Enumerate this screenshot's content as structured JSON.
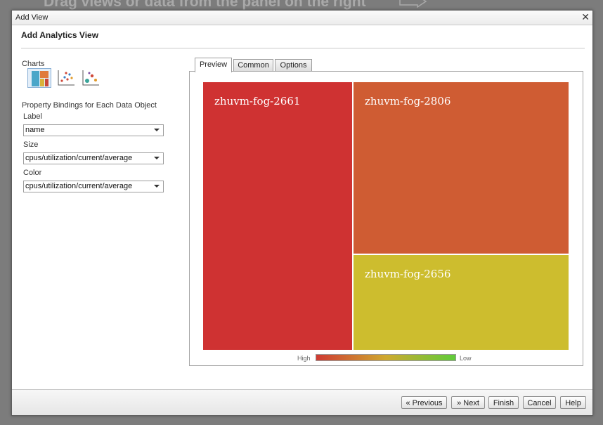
{
  "background": {
    "hint_text": "Drag views or data from the panel on the right"
  },
  "window": {
    "title": "Add View",
    "close_glyph": "✕"
  },
  "dialog": {
    "heading": "Add Analytics View"
  },
  "left": {
    "charts_label": "Charts",
    "chart_types": [
      {
        "name": "treemap",
        "icon": "treemap-icon",
        "selected": true
      },
      {
        "name": "scatter",
        "icon": "scatter-plot-icon",
        "selected": false
      },
      {
        "name": "bubble",
        "icon": "bubble-chart-icon",
        "selected": false
      }
    ],
    "bindings_title": "Property Bindings for Each Data Object",
    "label_caption": "Label",
    "label_value": "name",
    "size_caption": "Size",
    "size_value": "cpus/utilization/current/average",
    "color_caption": "Color",
    "color_value": "cpus/utilization/current/average"
  },
  "tabs": [
    {
      "label": "Preview",
      "active": true
    },
    {
      "label": "Common",
      "active": false
    },
    {
      "label": "Options",
      "active": false
    }
  ],
  "preview": {
    "tiles": [
      {
        "label": "zhuvm-fog-2661",
        "color": "#cf3232"
      },
      {
        "label": "zhuvm-fog-2806",
        "color": "#cf5c33"
      },
      {
        "label": "zhuvm-fog-2656",
        "color": "#cdbd2e"
      }
    ],
    "legend": {
      "high": "High",
      "low": "Low",
      "gradient": [
        "#cf3a33",
        "#cfa92f",
        "#5fcc3a"
      ]
    }
  },
  "footer": {
    "previous": "« Previous",
    "next": "» Next",
    "finish": "Finish",
    "cancel": "Cancel",
    "help": "Help"
  }
}
